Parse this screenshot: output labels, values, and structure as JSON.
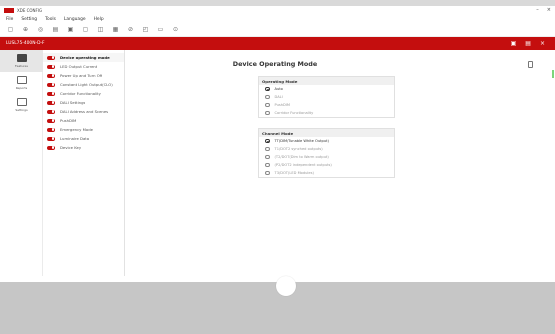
{
  "app": {
    "title": "XDE CONFIG",
    "window_controls": [
      "–",
      "×"
    ]
  },
  "menu": [
    "File",
    "Setting",
    "Tools",
    "Language",
    "Help"
  ],
  "toolbar": [
    {
      "icon": "new-icon",
      "glyph": "▢"
    },
    {
      "icon": "add-icon",
      "glyph": "⊕"
    },
    {
      "icon": "target-icon",
      "glyph": "◎"
    },
    {
      "icon": "calendar-icon",
      "glyph": "▤"
    },
    {
      "icon": "save-icon",
      "glyph": "▣"
    },
    {
      "icon": "export-icon",
      "glyph": "▢"
    },
    {
      "icon": "grid-icon",
      "glyph": "◫"
    },
    {
      "icon": "calculator-icon",
      "glyph": "▦"
    },
    {
      "icon": "search-icon",
      "glyph": "⊘"
    },
    {
      "icon": "layout-icon",
      "glyph": "◰"
    },
    {
      "icon": "window-icon",
      "glyph": "▭"
    },
    {
      "icon": "settings-icon",
      "glyph": "⊙"
    }
  ],
  "device": {
    "name": "LUSL75-400N-D-F",
    "actions": [
      {
        "icon": "read-icon",
        "glyph": "▣"
      },
      {
        "icon": "write-icon",
        "glyph": "▤"
      },
      {
        "icon": "close-icon",
        "glyph": "×"
      }
    ]
  },
  "rail": [
    {
      "label": "Features"
    },
    {
      "label": "Reports"
    },
    {
      "label": "Settings"
    }
  ],
  "features": [
    {
      "label": "Device operating mode"
    },
    {
      "label": "LED Output Current"
    },
    {
      "label": "Power Up and Turn Off"
    },
    {
      "label": "Constant Light Output(CLO)"
    },
    {
      "label": "Corridor Functionality"
    },
    {
      "label": "DALI Settings"
    },
    {
      "label": "DALI Address and Scenes"
    },
    {
      "label": "PushDIM"
    },
    {
      "label": "Emergency Mode"
    },
    {
      "label": "Luminaire Data"
    },
    {
      "label": "Device Key"
    }
  ],
  "main": {
    "title": "Device Operating Mode",
    "operating_mode": {
      "header": "Operating Mode",
      "options": [
        "Auto",
        "DALI",
        "PushDIM",
        "Corridor Functionality"
      ],
      "selected": "Auto"
    },
    "channel_mode": {
      "header": "Channel Mode",
      "options": [
        "TT(DIM/Tunable White Output)",
        "T1/DOT2 synched outputs)",
        "(T2/DOT(Dim to Warm output)",
        "(P2/DOT2 independent outputs)",
        "T3/DOT(LED Modules)"
      ],
      "selected": "TT(DIM/Tunable White Output)"
    }
  },
  "colors": {
    "brand_red": "#c40e0e",
    "selection_gray": "#e6e6e6"
  }
}
